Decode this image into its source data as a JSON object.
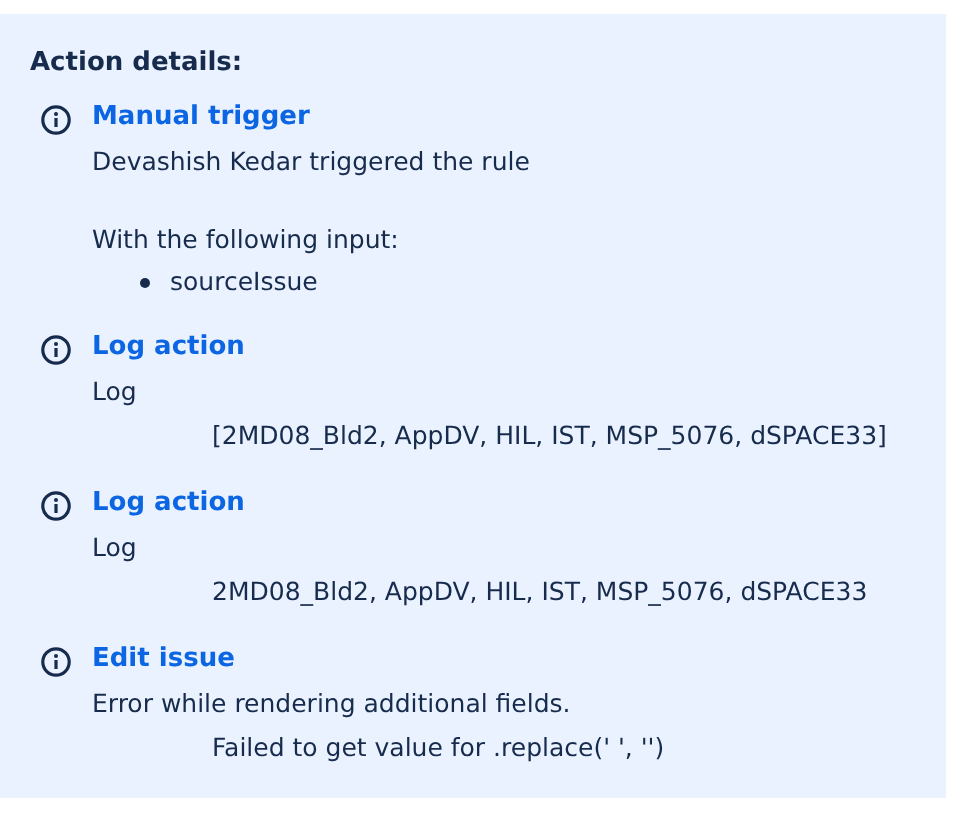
{
  "heading": "Action details:",
  "actions": [
    {
      "title": "Manual trigger",
      "lines": [
        {
          "kind": "plain",
          "text": "Devashish Kedar triggered the rule"
        },
        {
          "kind": "paragraph",
          "text": "With the following input:"
        },
        {
          "kind": "bullet",
          "text": "sourceIssue"
        }
      ]
    },
    {
      "title": "Log action",
      "lines": [
        {
          "kind": "plain",
          "text": "Log"
        },
        {
          "kind": "indented",
          "text": "[2MD08_Bld2, AppDV, HIL, IST, MSP_5076, dSPACE33]"
        }
      ]
    },
    {
      "title": "Log action",
      "lines": [
        {
          "kind": "plain",
          "text": "Log"
        },
        {
          "kind": "indented",
          "text": "2MD08_Bld2, AppDV, HIL, IST, MSP_5076, dSPACE33"
        }
      ]
    },
    {
      "title": "Edit issue",
      "lines": [
        {
          "kind": "plain",
          "text": "Error while rendering additional fields."
        },
        {
          "kind": "indented",
          "text": "Failed to get value for .replace(' ', '')"
        }
      ]
    }
  ]
}
